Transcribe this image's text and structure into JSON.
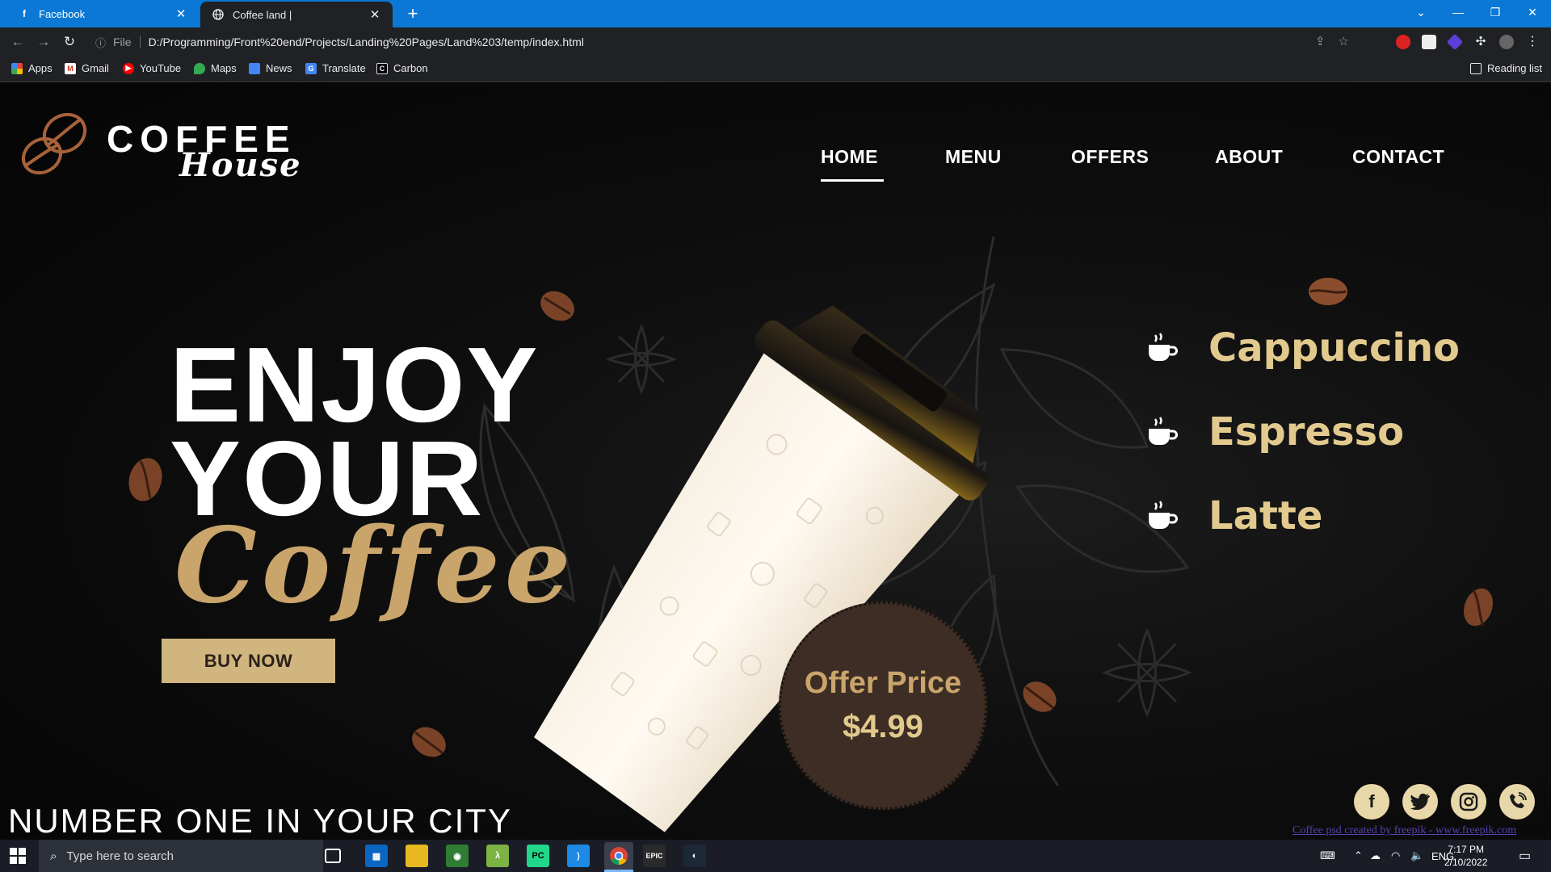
{
  "browser": {
    "tabs": [
      {
        "label": "Facebook",
        "active": false
      },
      {
        "label": "Coffee land |",
        "active": true
      }
    ],
    "url_scheme": "File",
    "url": "D:/Programming/Front%20end/Projects/Landing%20Pages/Land%203/temp/index.html",
    "bookmarks": [
      "Apps",
      "Gmail",
      "YouTube",
      "Maps",
      "News",
      "Translate",
      "Carbon"
    ],
    "reading_list": "Reading list"
  },
  "site": {
    "logo": {
      "line1": "COFFEE",
      "line2": "House"
    },
    "nav": [
      "HOME",
      "MENU",
      "OFFERS",
      "ABOUT",
      "CONTACT"
    ],
    "active_nav": "HOME",
    "hero": {
      "line1": "ENJOY",
      "line2": "YOUR",
      "line3": "Coffee"
    },
    "cta": "BUY NOW",
    "menu_items": [
      "Cappuccino",
      "Espresso",
      "Latte"
    ],
    "offer": {
      "label": "Offer Price",
      "price": "$4.99"
    },
    "tagline": "NUMBER ONE IN YOUR CITY",
    "social_icons": [
      "facebook-icon",
      "twitter-icon",
      "instagram-icon",
      "phone-icon"
    ],
    "credit": "Coffee psd created by freepik - www.freepik.com",
    "colors": {
      "gold": "#c9a56b",
      "button": "#d0b57f",
      "offer_circle": "#3d2d24"
    }
  },
  "taskbar": {
    "search_placeholder": "Type here to search",
    "language": "ENG",
    "time": "7:17 PM",
    "date": "2/10/2022"
  }
}
